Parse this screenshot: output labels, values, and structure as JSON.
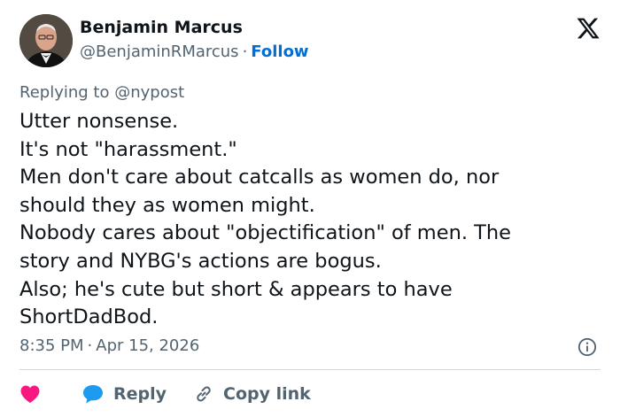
{
  "author": {
    "name": "Benjamin Marcus",
    "handle": "@BenjaminRMarcus",
    "separator": "·",
    "follow_label": "Follow"
  },
  "reply_context": {
    "prefix": "Replying to",
    "mention": "@nypost"
  },
  "tweet": {
    "lines": [
      "Utter nonsense.",
      "It's not \"harassment.\"",
      "Men don't care about catcalls as women do, nor",
      "should they as women might.",
      "Nobody cares about \"objectification\" of men. The",
      "story and NYBG's actions are bogus.",
      "Also; he's cute but short & appears to have",
      "ShortDadBod."
    ]
  },
  "meta": {
    "time": "8:35 PM",
    "separator": "·",
    "date": "Apr 15, 2026"
  },
  "actions": {
    "reply_label": "Reply",
    "copy_link_label": "Copy link"
  },
  "colors": {
    "text": "#0f1419",
    "secondary": "#536471",
    "link": "#006fd6",
    "heart": "#f91880",
    "reply_icon": "#1d9bf0",
    "divider": "#cfd9de"
  },
  "icons": [
    "x-logo-icon",
    "info-icon",
    "heart-icon",
    "reply-bubble-icon",
    "link-icon"
  ]
}
